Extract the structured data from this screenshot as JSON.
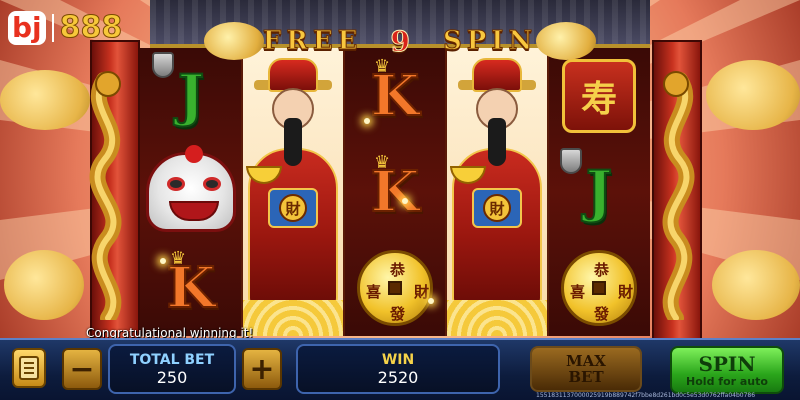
{
  "logo": {
    "brand_left": "bj",
    "brand_right": "888"
  },
  "banner": {
    "word_left": "FREE",
    "number": "9",
    "word_right": "SPIN"
  },
  "reels": {
    "reel1": [
      "J",
      "lion-head",
      "K"
    ],
    "reel2": [
      "wealth-god"
    ],
    "reel3": [
      "K",
      "K",
      "coin"
    ],
    "reel4": [
      "wealth-god"
    ],
    "reel5": [
      "longevity-tile",
      "J",
      "coin"
    ],
    "tile_char": "寿",
    "badge_char": "財",
    "coin_chars": [
      "恭",
      "喜",
      "財",
      "發"
    ]
  },
  "message": "Congratulational winning it!",
  "controls": {
    "total_bet_label": "TOTAL BET",
    "total_bet_value": "250",
    "win_label": "WIN",
    "win_value": "2520",
    "minus_label": "−",
    "plus_label": "+",
    "max_bet_line1": "MAX",
    "max_bet_line2": "BET",
    "spin_label": "SPIN",
    "spin_sub": "Hold for auto"
  },
  "round_hash": "1551831137000025919b889742f7bbe8d261bd0c5e53d0762ffa04b0786",
  "colors": {
    "accent_gold": "#f7c83a",
    "spin_green": "#2aa51b",
    "panel_blue": "#0b1b3f",
    "brand_red": "#e8311f"
  }
}
